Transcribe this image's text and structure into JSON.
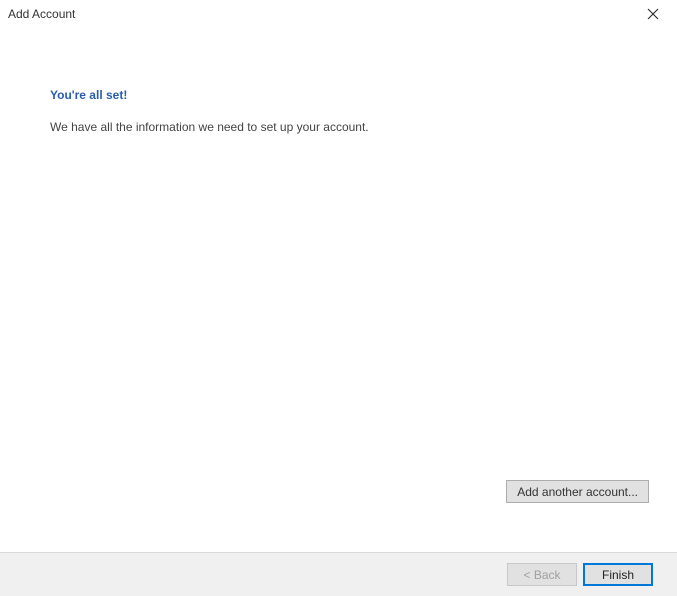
{
  "titlebar": {
    "title": "Add Account"
  },
  "content": {
    "heading": "You're all set!",
    "subtext": "We have all the information we need to set up your account."
  },
  "buttons": {
    "add_another": "Add another account...",
    "back": "< Back",
    "finish": "Finish"
  }
}
